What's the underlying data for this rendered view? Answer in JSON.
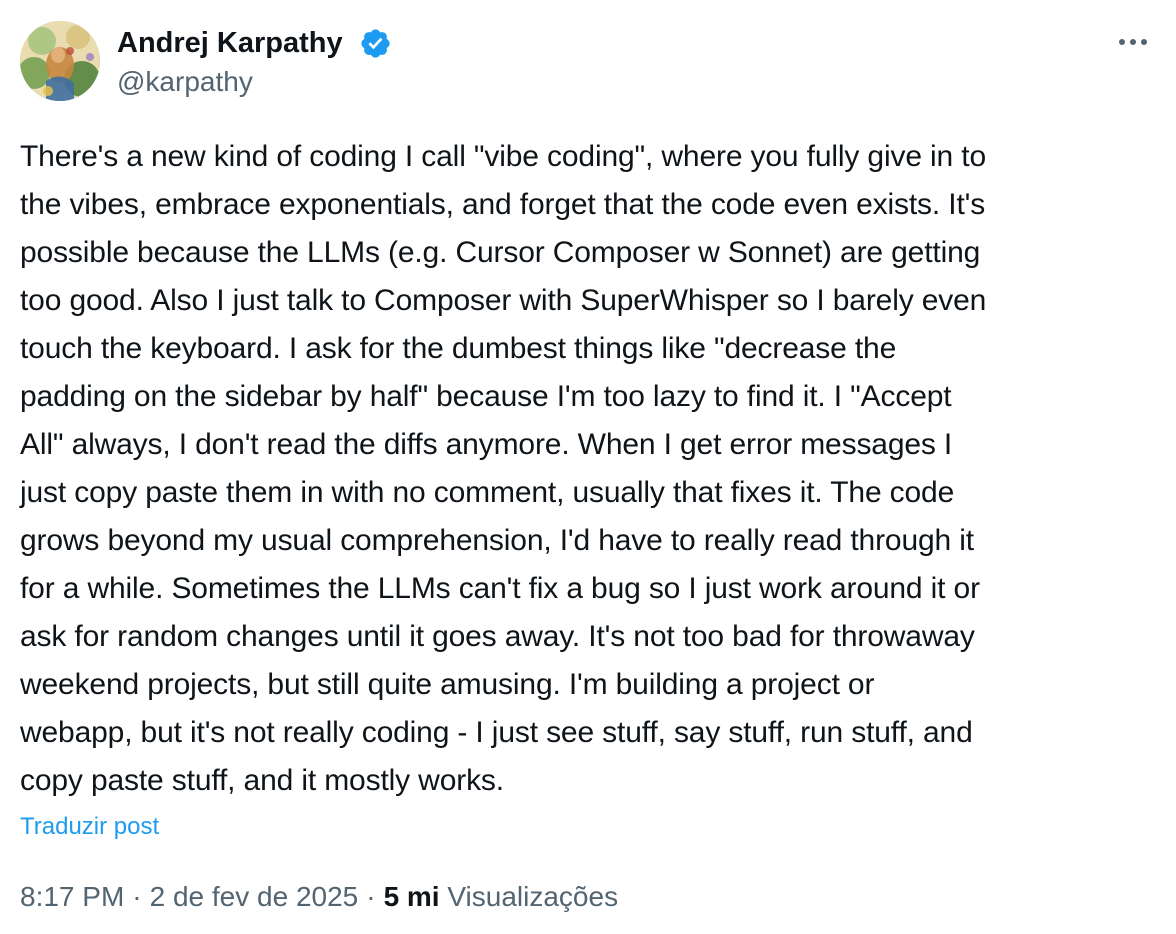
{
  "author": {
    "name": "Andrej Karpathy",
    "handle": "@karpathy",
    "verified": true,
    "verified_color": "#1d9bf0"
  },
  "icons": {
    "more": "more-horizontal-icon",
    "verified": "verified-badge-icon"
  },
  "tweet": {
    "lines": [
      "There's a new kind of coding I call \"vibe coding\", where you fully give in to",
      "the vibes, embrace exponentials, and forget that the code even exists. It's",
      "possible because the LLMs (e.g. Cursor Composer w Sonnet) are getting",
      "too good. Also I just talk to Composer with SuperWhisper so I barely even",
      "touch the keyboard. I ask for the dumbest things like \"decrease the",
      "padding on the sidebar by half\" because I'm too lazy to find it. I \"Accept",
      "All\" always, I don't read the diffs anymore. When I get error messages I",
      "just copy paste them in with no comment, usually that fixes it. The code",
      "grows beyond my usual comprehension, I'd have to really read through it",
      "for a while. Sometimes the LLMs can't fix a bug so I just work around it or",
      "ask for random changes until it goes away. It's not too bad for throwaway",
      "weekend projects, but still quite amusing. I'm building a project or",
      "webapp, but it's not really coding - I just see stuff, say stuff, run stuff, and",
      "copy paste stuff, and it mostly works."
    ],
    "translate_label": "Traduzir post"
  },
  "meta": {
    "time": "8:17 PM",
    "separator": "·",
    "date": "2 de fev de 2025",
    "views_count": "5 mi",
    "views_label": "Visualizações"
  },
  "colors": {
    "text": "#0f1419",
    "secondary": "#536471",
    "link": "#1d9bf0"
  }
}
